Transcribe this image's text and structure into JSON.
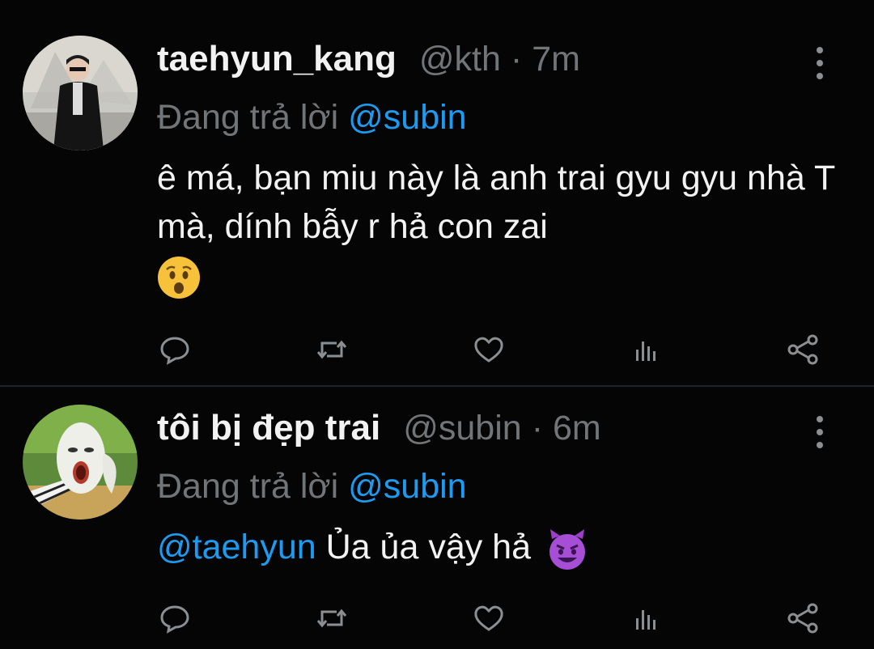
{
  "tweets": [
    {
      "name": "taehyun_kang",
      "handle": "@kth",
      "separator": "·",
      "time": "7m",
      "replying_prefix": "Đang trả lời",
      "replying_to": "@subin",
      "text": "ê má, bạn miu này là anh trai gyu gyu nhà T mà, dính bẫy r hả con zai",
      "emoji": "hushed-face-emoji"
    },
    {
      "name": "tôi bị đẹp trai",
      "handle": "@subin",
      "separator": "·",
      "time": "6m",
      "replying_prefix": "Đang trả lời",
      "replying_to": "@subin",
      "text_mention": "@taehyun",
      "text": "Ủa ủa vậy hả",
      "emoji": "smiling-devil-emoji"
    }
  ],
  "actions": [
    "reply-icon",
    "retweet-icon",
    "like-icon",
    "analytics-icon",
    "share-icon"
  ],
  "colors": {
    "background": "#050505",
    "accent": "#1d9bf0",
    "secondary_text": "#717578",
    "primary_text": "#f2f2f2"
  }
}
